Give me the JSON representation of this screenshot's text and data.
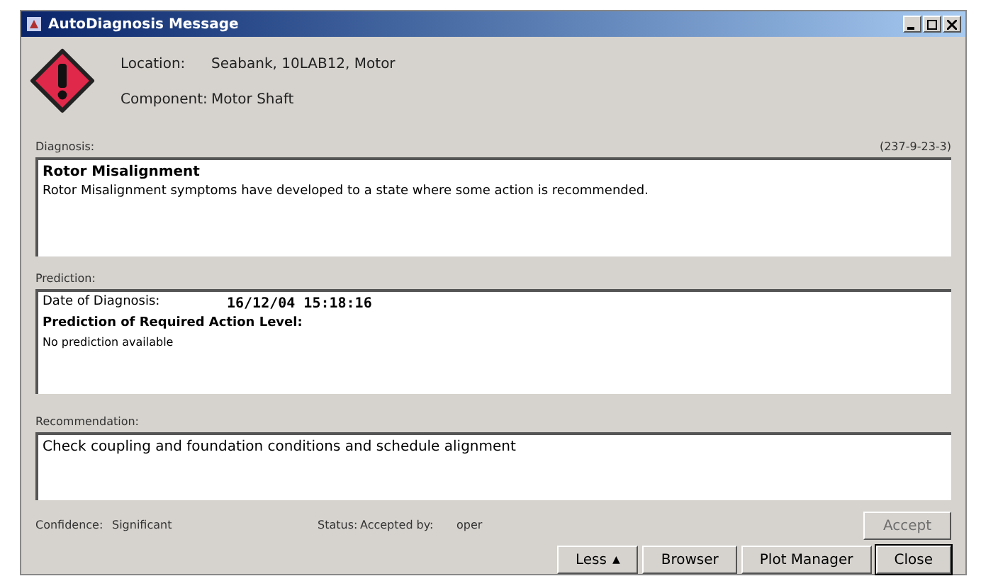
{
  "window": {
    "title": "AutoDiagnosis Message"
  },
  "header": {
    "location_label": "Location:",
    "location": "Seabank, 10LAB12, Motor",
    "component_label": "Component:",
    "component": "Motor Shaft"
  },
  "diagnosis": {
    "label": "Diagnosis:",
    "code": "(237-9-23-3)",
    "title": "Rotor Misalignment",
    "text": "Rotor Misalignment symptoms have developed to a state where some action is recommended."
  },
  "prediction": {
    "label": "Prediction:",
    "date_label": "Date of Diagnosis:",
    "date": "16/12/04 15:18:16",
    "level_label": "Prediction of Required Action Level:",
    "text": "No prediction available"
  },
  "recommendation": {
    "label": "Recommendation:",
    "text": "Check coupling and foundation conditions and schedule alignment"
  },
  "status_row": {
    "confidence_label": "Confidence:",
    "confidence": "Significant",
    "status_label": "Status:",
    "status": "Accepted by:",
    "user": "oper"
  },
  "accept_button": {
    "label": "Accept",
    "disabled": true
  },
  "buttons": [
    {
      "label": "Less",
      "arrow": "▲",
      "default": false
    },
    {
      "label": "Browser",
      "default": false
    },
    {
      "label": "Plot Manager",
      "default": false
    },
    {
      "label": "Close",
      "default": true
    }
  ]
}
